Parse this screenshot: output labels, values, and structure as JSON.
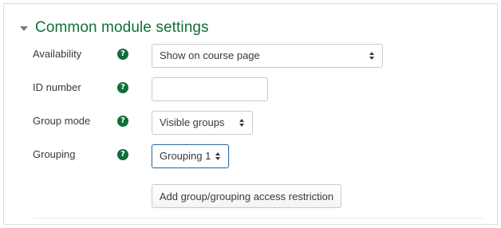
{
  "section": {
    "title": "Common module settings",
    "expanded": true,
    "accent_color": "#0f6f3a"
  },
  "fields": {
    "availability": {
      "label": "Availability",
      "help_glyph": "?",
      "value": "Show on course page"
    },
    "id_number": {
      "label": "ID number",
      "help_glyph": "?",
      "value": ""
    },
    "group_mode": {
      "label": "Group mode",
      "help_glyph": "?",
      "value": "Visible groups"
    },
    "grouping": {
      "label": "Grouping",
      "help_glyph": "?",
      "value": "Grouping 1"
    }
  },
  "actions": {
    "add_restriction_label": "Add group/grouping access restriction"
  },
  "icons": {
    "section_toggle": "caret-down-icon",
    "help": "question-circle-icon",
    "select_arrows": "up-down-arrows-icon"
  }
}
